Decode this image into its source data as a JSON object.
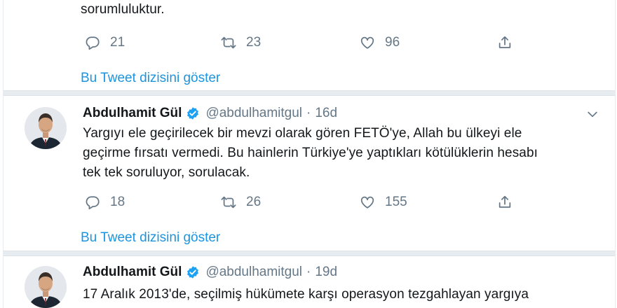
{
  "top_tweet": {
    "text_last_line": "sorumluluktur.",
    "replies": "21",
    "retweets": "23",
    "likes": "96",
    "thread_link": "Bu Tweet dizisini göster"
  },
  "tweet1": {
    "name": "Abdulhamit Gül",
    "handle": "@abdulhamitgul",
    "separator": "·",
    "time": "16d",
    "text_lines": [
      "Yargıyı ele geçirilecek bir mevzi olarak gören FETÖ'ye, Allah bu ülkeyi ele",
      "geçirme fırsatı vermedi. Bu hainlerin Türkiye'ye yaptıkları kötülüklerin hesabı",
      "tek tek soruluyor, sorulacak."
    ],
    "replies": "18",
    "retweets": "26",
    "likes": "155",
    "thread_link": "Bu Tweet dizisini göster"
  },
  "tweet2": {
    "name": "Abdulhamit Gül",
    "handle": "@abdulhamitgul",
    "separator": "·",
    "time": "19d",
    "text_line": "17 Aralık 2013'de, seçilmiş hükümete karşı operasyon tezgahlayan yargıya"
  },
  "colors": {
    "link": "#1b95e0",
    "muted": "#657786",
    "text": "#14171a",
    "divider": "#e6ecf0",
    "verified": "#1da1f2"
  },
  "icons": [
    "reply-icon",
    "retweet-icon",
    "like-icon",
    "share-icon",
    "verified-badge-icon",
    "chevron-down-icon"
  ]
}
